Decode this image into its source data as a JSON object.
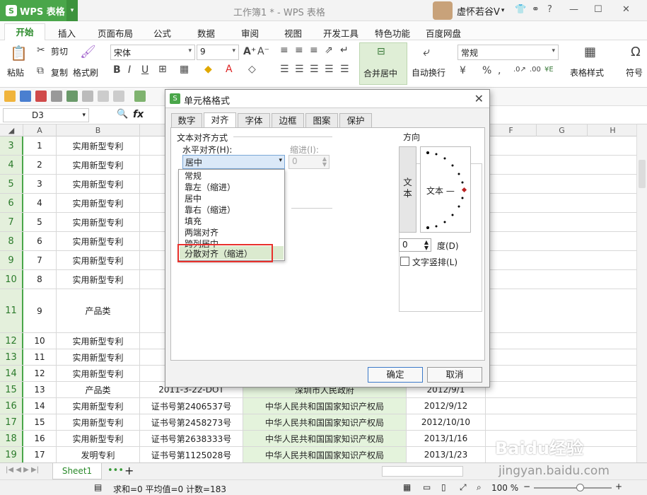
{
  "app": {
    "brand": "WPS 表格",
    "doc_title": "工作簿1 * - WPS 表格",
    "user_name": "虚怀若谷V"
  },
  "menu": [
    "开始",
    "插入",
    "页面布局",
    "公式",
    "数据",
    "审阅",
    "视图",
    "开发工具",
    "特色功能",
    "百度网盘"
  ],
  "ribbon": {
    "paste": "粘贴",
    "cut": "剪切",
    "copy": "复制",
    "format_painter": "格式刷",
    "font_name": "宋体",
    "font_size": "9",
    "merge_center": "合并居中",
    "wrap": "自动换行",
    "number_format": "常规",
    "table_style": "表格样式",
    "symbol": "符号"
  },
  "formula_bar": {
    "name_box": "D3",
    "fx": "fx"
  },
  "columns": [
    "A",
    "B",
    "C",
    "D",
    "E",
    "F",
    "G",
    "H"
  ],
  "rows": [
    {
      "r": "3",
      "a": "1",
      "b": "实用新型专利",
      "c": "证",
      "d": "",
      "e": ""
    },
    {
      "r": "4",
      "a": "2",
      "b": "实用新型专利",
      "c": "证",
      "d": "",
      "e": ""
    },
    {
      "r": "5",
      "a": "3",
      "b": "实用新型专利",
      "c": "证",
      "d": "",
      "e": ""
    },
    {
      "r": "6",
      "a": "4",
      "b": "实用新型专利",
      "c": "证",
      "d": "",
      "e": ""
    },
    {
      "r": "7",
      "a": "5",
      "b": "实用新型专利",
      "c": "证",
      "d": "",
      "e": ""
    },
    {
      "r": "8",
      "a": "6",
      "b": "实用新型专利",
      "c": "证",
      "d": "",
      "e": ""
    },
    {
      "r": "9",
      "a": "7",
      "b": "实用新型专利",
      "c": "证",
      "d": "",
      "e": ""
    },
    {
      "r": "10",
      "a": "8",
      "b": "实用新型专利",
      "c": "证",
      "d": "",
      "e": ""
    },
    {
      "r": "11",
      "a": "9",
      "b": "产品类",
      "c": "",
      "d": "",
      "e": ""
    },
    {
      "r": "12",
      "a": "10",
      "b": "实用新型专利",
      "c": "证",
      "d": "",
      "e": ""
    },
    {
      "r": "13",
      "a": "11",
      "b": "实用新型专利",
      "c": "证",
      "d": "",
      "e": ""
    },
    {
      "r": "14",
      "a": "12",
      "b": "实用新型专利",
      "c": "证",
      "d": "",
      "e": ""
    },
    {
      "r": "15",
      "a": "13",
      "b": "产品类",
      "c": "2011-3-22-DOT",
      "d": "深圳市人民政府",
      "e": "2012/9/1"
    },
    {
      "r": "16",
      "a": "14",
      "b": "实用新型专利",
      "c": "证书号第2406537号",
      "d": "中华人民共和国国家知识产权局",
      "e": "2012/9/12"
    },
    {
      "r": "17",
      "a": "15",
      "b": "实用新型专利",
      "c": "证书号第2458273号",
      "d": "中华人民共和国国家知识产权局",
      "e": "2012/10/10"
    },
    {
      "r": "18",
      "a": "16",
      "b": "实用新型专利",
      "c": "证书号第2638333号",
      "d": "中华人民共和国国家知识产权局",
      "e": "2013/1/16"
    },
    {
      "r": "19",
      "a": "17",
      "b": "发明专利",
      "c": "证书号第1125028号",
      "d": "中华人民共和国国家知识产权局",
      "e": "2013/1/23"
    }
  ],
  "sheet": {
    "tab": "Sheet1"
  },
  "status": {
    "text": "求和=0  平均值=0  计数=183",
    "zoom": "100 %"
  },
  "watermark": {
    "brand": "Baidu经验",
    "url": "jingyan.baidu.com"
  },
  "dialog": {
    "title": "单元格格式",
    "tabs": [
      "数字",
      "对齐",
      "字体",
      "边框",
      "图案",
      "保护"
    ],
    "text_align_section": "文本对齐方式",
    "horizontal_label": "水平对齐(H):",
    "horizontal_value": "居中",
    "indent_label": "缩进(I):",
    "indent_value": "0",
    "dropdown_options": [
      "常规",
      "靠左（缩进）",
      "居中",
      "靠右（缩进）",
      "填充",
      "两端对齐",
      "跨列居中",
      "分散对齐（缩进）"
    ],
    "orientation_label": "方向",
    "vertical_text": "文本",
    "dial_text": "文本 —",
    "degree_value": "0",
    "degree_label": "度(D)",
    "vertical_checkbox": "文字竖排(L)",
    "ok": "确定",
    "cancel": "取消"
  },
  "colors": {
    "brand_green": "#4aa64a",
    "highlight_red": "#e8312c"
  }
}
